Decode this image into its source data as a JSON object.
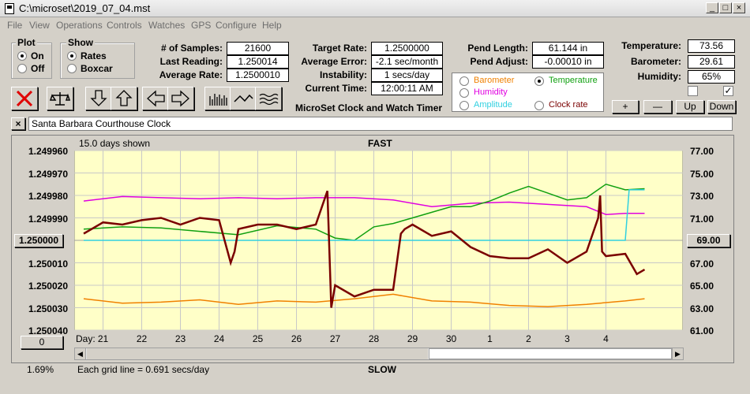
{
  "window": {
    "title": "C:\\microset\\2019_07_04.mst"
  },
  "menu": [
    "File",
    "View",
    "Operations",
    "Controls",
    "Watches",
    "GPS",
    "Configure",
    "Help"
  ],
  "plot_group": {
    "title": "Plot",
    "on": "On",
    "off": "Off",
    "selected": "On"
  },
  "show_group": {
    "title": "Show",
    "rates": "Rates",
    "boxcar": "Boxcar",
    "selected": "Rates"
  },
  "stats": {
    "samples_label": "# of Samples:",
    "samples": "21600",
    "last_label": "Last Reading:",
    "last": "1.250014",
    "avg_label": "Average Rate:",
    "avg": "1.2500010",
    "target_label": "Target Rate:",
    "target": "1.2500000",
    "avgerr_label": "Average Error:",
    "avgerr": "-2.1 sec/month",
    "instab_label": "Instability:",
    "instab": "1 secs/day",
    "time_label": "Current Time:",
    "time": "12:00:11 AM",
    "pendlen_label": "Pend Length:",
    "pendlen": "61.144 in",
    "pendadj_label": "Pend Adjust:",
    "pendadj": "-0.00010 in",
    "temp_label": "Temperature:",
    "temp": "73.56",
    "baro_label": "Barometer:",
    "baro": "29.61",
    "hum_label": "Humidity:",
    "hum": "65%",
    "brand": "MicroSet Clock and Watch Timer"
  },
  "channels": {
    "barometer": "Barometer",
    "temperature": "Temperature",
    "humidity": "Humidity",
    "amplitude": "Amplitude",
    "clockrate": "Clock rate",
    "selected": "Temperature"
  },
  "scale_buttons": [
    "+",
    "—",
    "Up",
    "Down"
  ],
  "clock_name": "Santa Barbara Courthouse Clock",
  "chart": {
    "days_shown": "15.0 days shown",
    "top_label": "FAST",
    "bottom_label": "SLOW",
    "center_value": "1.250000",
    "right_center_value": "69.00",
    "left_button": "0",
    "bottom_left_pct": "1.69%",
    "grid_note": "Each grid line = 0.691 secs/day",
    "day_prefix": "Day:"
  },
  "chart_data": {
    "type": "line",
    "title": "",
    "x_ticks": [
      "21",
      "22",
      "23",
      "24",
      "25",
      "26",
      "27",
      "28",
      "29",
      "30",
      "1",
      "2",
      "3",
      "4"
    ],
    "y_left_ticks": [
      "1.249960",
      "1.249970",
      "1.249980",
      "1.249990",
      "1.250000",
      "1.250010",
      "1.250020",
      "1.250030",
      "1.250040"
    ],
    "y_right_ticks": [
      "77.00",
      "75.00",
      "73.00",
      "71.00",
      "69.00",
      "67.00",
      "65.00",
      "63.00",
      "61.00"
    ],
    "ylim_left": [
      1.24996,
      1.25004
    ],
    "ylim_right": [
      61,
      77
    ],
    "grid": true,
    "series": [
      {
        "name": "Clock rate",
        "color": "#7a0000",
        "axis": "left",
        "x": [
          20.0,
          20.5,
          21.0,
          21.5,
          22.0,
          22.5,
          23.0,
          23.5,
          23.8,
          23.9,
          24.0,
          24.5,
          25.0,
          25.5,
          26.0,
          26.3,
          26.4,
          26.45,
          26.5,
          27.0,
          27.5,
          28.0,
          28.2,
          28.3,
          28.5,
          29.0,
          29.5,
          30.0,
          30.5,
          31.0,
          31.5,
          32.0,
          32.5,
          33.0,
          33.3,
          33.35,
          33.4,
          33.5,
          34.0,
          34.3,
          34.5
        ],
        "values": [
          1.249997,
          1.249992,
          1.249993,
          1.249991,
          1.24999,
          1.249993,
          1.24999,
          1.249991,
          1.25001,
          1.250005,
          1.249995,
          1.249993,
          1.249993,
          1.249995,
          1.249993,
          1.249978,
          1.25003,
          1.250025,
          1.25002,
          1.250025,
          1.250022,
          1.250022,
          1.249997,
          1.249995,
          1.249993,
          1.249998,
          1.249996,
          1.250003,
          1.250007,
          1.250008,
          1.250008,
          1.250004,
          1.25001,
          1.250005,
          1.24999,
          1.24998,
          1.250005,
          1.250007,
          1.250006,
          1.250015,
          1.250013
        ]
      },
      {
        "name": "Temperature",
        "color": "#10a010",
        "axis": "right",
        "x": [
          20.0,
          21.0,
          22.0,
          23.0,
          24.0,
          25.0,
          26.0,
          26.5,
          27.0,
          27.5,
          28.0,
          28.5,
          29.0,
          29.5,
          30.0,
          30.5,
          31.0,
          31.5,
          32.0,
          32.5,
          33.0,
          33.5,
          34.0,
          34.5
        ],
        "values": [
          70.0,
          70.2,
          70.1,
          69.8,
          69.5,
          70.3,
          70.0,
          69.2,
          69.0,
          70.2,
          70.5,
          71.0,
          71.5,
          72.0,
          72.0,
          72.5,
          73.2,
          73.8,
          73.2,
          72.6,
          72.8,
          74.0,
          73.5,
          73.6
        ]
      },
      {
        "name": "Humidity",
        "color": "#e000e0",
        "axis": "right",
        "x": [
          20.0,
          21.0,
          22.0,
          23.0,
          24.0,
          25.0,
          26.0,
          27.0,
          28.0,
          29.0,
          30.0,
          31.0,
          32.0,
          33.0,
          33.5,
          34.0,
          34.5
        ],
        "values": [
          72.5,
          72.9,
          72.8,
          72.7,
          72.8,
          72.7,
          72.8,
          72.8,
          72.6,
          72.0,
          72.3,
          72.4,
          72.2,
          72.0,
          71.3,
          71.4,
          71.4
        ]
      },
      {
        "name": "Barometer",
        "color": "#f08000",
        "axis": "right",
        "x": [
          20.0,
          21.0,
          22.0,
          23.0,
          24.0,
          25.0,
          26.0,
          27.0,
          28.0,
          29.0,
          30.0,
          31.0,
          32.0,
          33.0,
          34.0,
          34.5
        ],
        "values": [
          63.8,
          63.4,
          63.5,
          63.7,
          63.3,
          63.6,
          63.5,
          63.8,
          64.2,
          63.6,
          63.5,
          63.2,
          63.1,
          63.3,
          63.6,
          63.8
        ]
      },
      {
        "name": "Amplitude",
        "color": "#30d0e0",
        "axis": "right",
        "x": [
          20.0,
          33.5,
          34.0,
          34.1,
          34.5
        ],
        "values": [
          69.0,
          69.0,
          69.0,
          73.5,
          73.5
        ]
      }
    ]
  }
}
